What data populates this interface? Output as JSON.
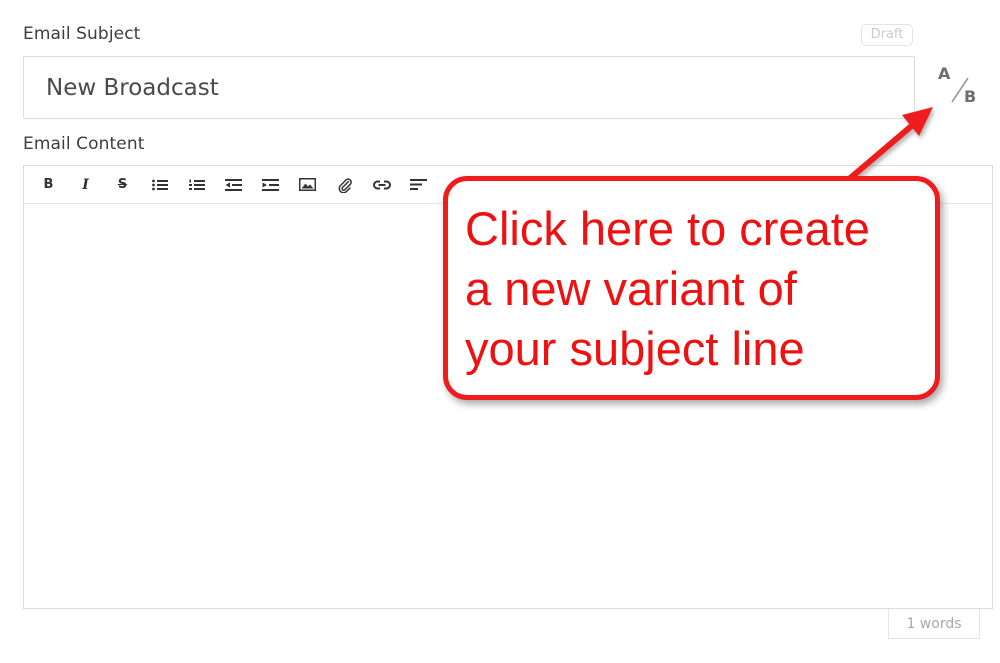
{
  "subject": {
    "label": "Email Subject",
    "value": "New Broadcast",
    "status_badge": "Draft"
  },
  "ab_test": {
    "a_label": "A",
    "b_label": "B",
    "icon": "ab-split-icon"
  },
  "content": {
    "label": "Email Content",
    "toolbar": [
      {
        "name": "bold-button",
        "glyph": "B",
        "icon": "bold-icon"
      },
      {
        "name": "italic-button",
        "glyph": "I",
        "icon": "italic-icon"
      },
      {
        "name": "strikethrough-button",
        "glyph": "S",
        "icon": "strikethrough-icon"
      },
      {
        "name": "bulleted-list-button",
        "icon": "bulleted-list-icon"
      },
      {
        "name": "numbered-list-button",
        "icon": "numbered-list-icon"
      },
      {
        "name": "outdent-button",
        "icon": "outdent-icon"
      },
      {
        "name": "indent-button",
        "icon": "indent-icon"
      },
      {
        "name": "image-button",
        "icon": "image-icon"
      },
      {
        "name": "attachment-button",
        "icon": "paperclip-icon"
      },
      {
        "name": "link-button",
        "icon": "link-icon"
      },
      {
        "name": "align-button",
        "icon": "align-left-icon"
      }
    ],
    "body": "",
    "word_count": "1 words"
  },
  "callout": {
    "text": "Click here to create\na new variant of\nyour subject line",
    "color": "#ee1c1c"
  }
}
